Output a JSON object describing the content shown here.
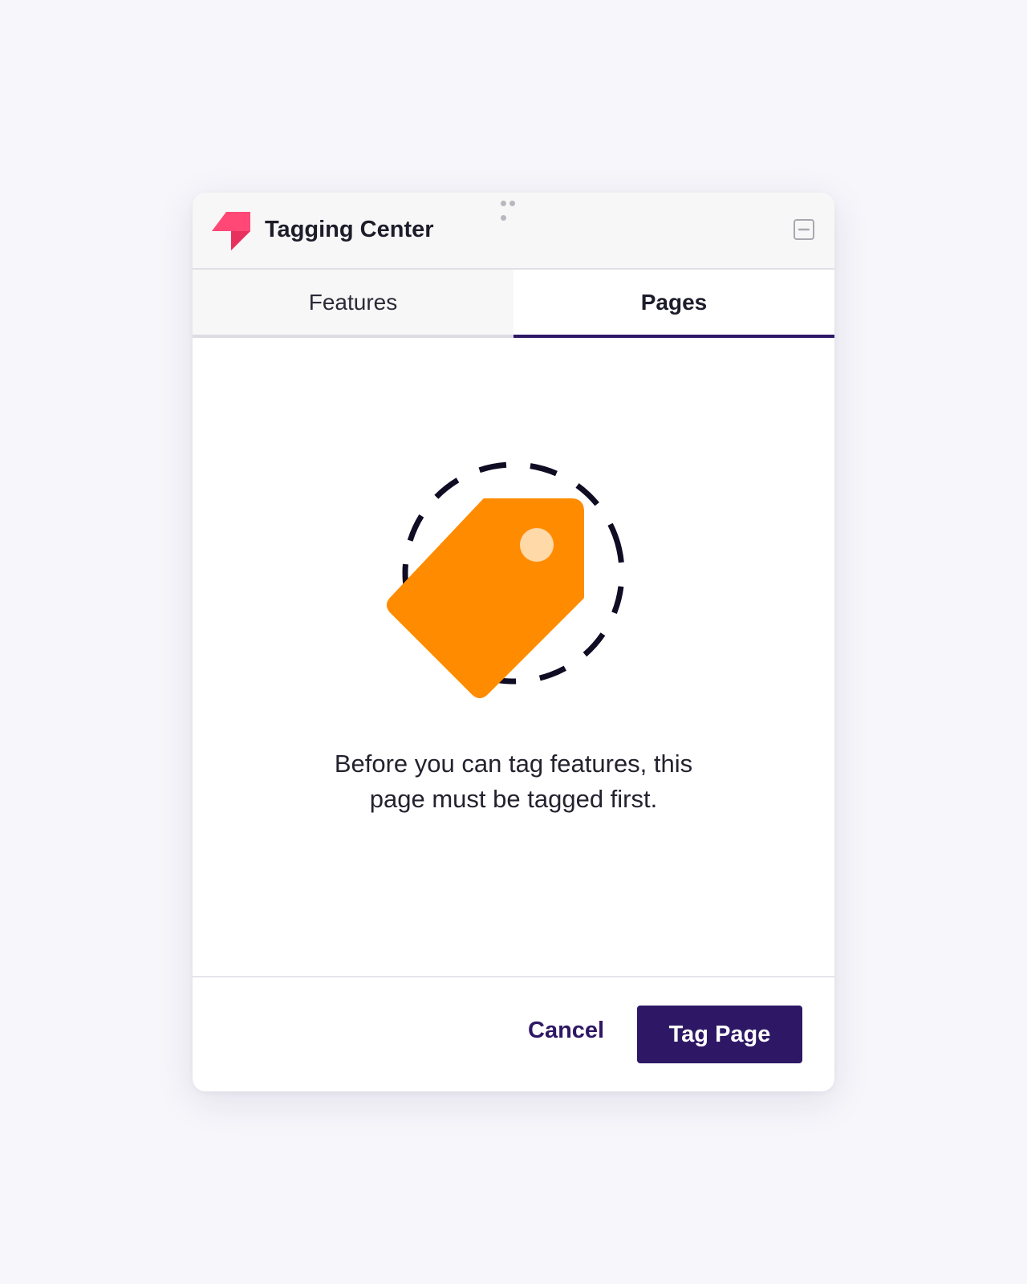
{
  "window": {
    "title": "Tagging Center"
  },
  "icons": {
    "logo": "pendo-logo-icon",
    "drag_handle": "drag-handle-icon",
    "minimize": "minimize-icon",
    "illustration": "price-tag-icon"
  },
  "tabs": [
    {
      "label": "Features",
      "active": false
    },
    {
      "label": "Pages",
      "active": true
    }
  ],
  "main": {
    "message": "Before you can tag features, this\npage must be tagged first."
  },
  "footer": {
    "cancel_label": "Cancel",
    "primary_label": "Tag Page"
  },
  "colors": {
    "page_background": "#f7f6fb",
    "header_background": "#f7f7f7",
    "brand_pink": "#ff4876",
    "primary": "#2e1865",
    "tag_orange": "#ff8c00",
    "tag_hole": "#ffd9a8",
    "dashed_ring": "#0f0c24"
  }
}
